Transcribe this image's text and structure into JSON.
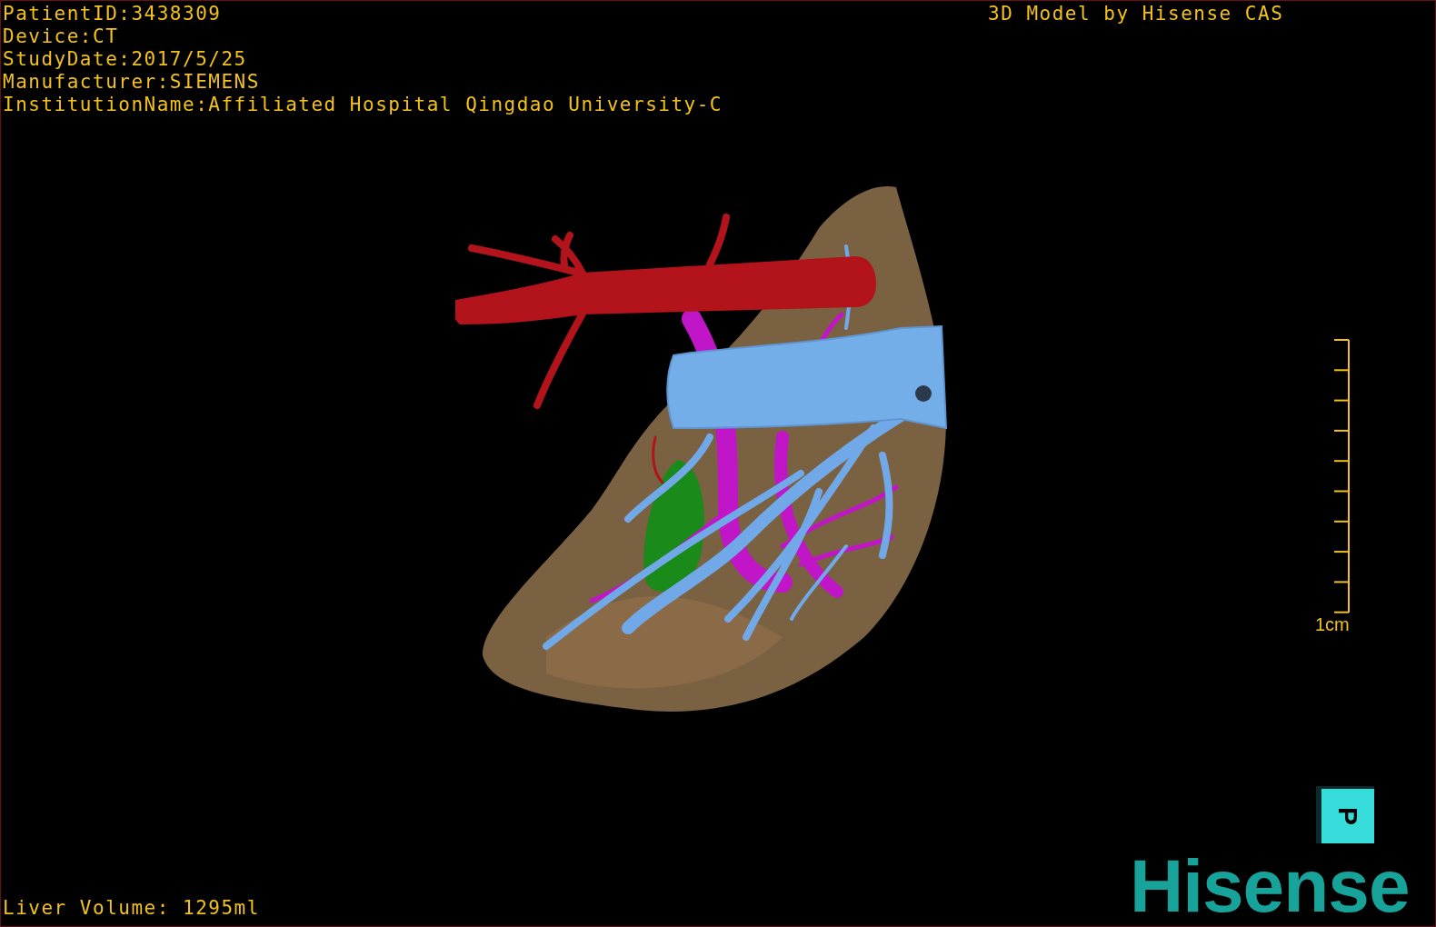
{
  "study_info": [
    "PatientID:3438309",
    "Device:CT",
    "StudyDate:2017/5/25",
    "Manufacturer:SIEMENS",
    "InstitutionName:Affiliated Hospital Qingdao University-C"
  ],
  "model_caption": "3D Model by Hisense CAS",
  "scale_bar": {
    "label": "1cm"
  },
  "orientation_cube": {
    "letter": "P"
  },
  "logo": "Hisense",
  "liver_volume": "Liver Volume: 1295ml"
}
